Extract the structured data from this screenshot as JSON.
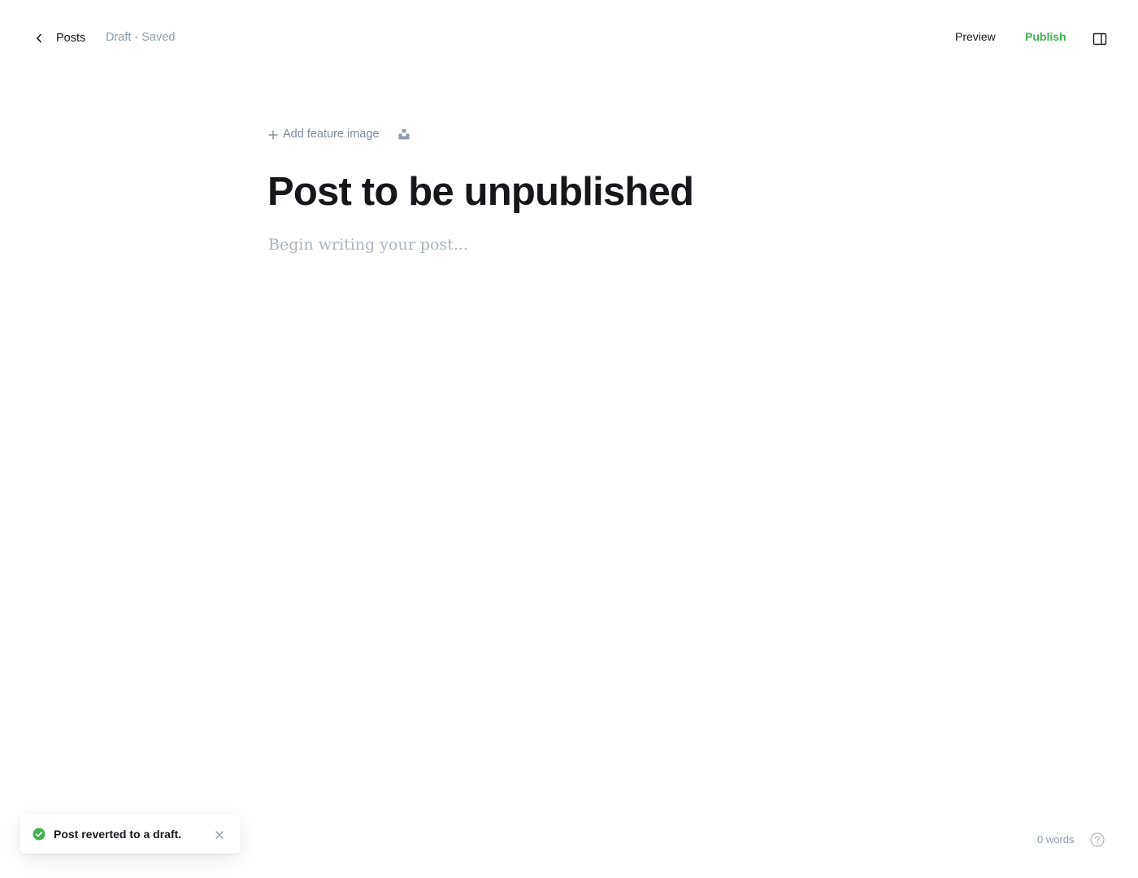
{
  "header": {
    "back_label": "Posts",
    "status": "Draft - Saved",
    "preview_label": "Preview",
    "publish_label": "Publish",
    "icons": {
      "back": "chevron-left-icon",
      "sidebar": "sidebar-toggle-icon"
    }
  },
  "editor": {
    "add_feature_image_label": "Add feature image",
    "title": "Post to be unpublished",
    "body_placeholder": "Begin writing your post...",
    "icons": {
      "add": "plus-icon",
      "unsplash": "unsplash-icon"
    }
  },
  "toast": {
    "message": "Post reverted to a draft.",
    "icons": {
      "status": "check-circle-icon",
      "close": "close-icon"
    }
  },
  "footer": {
    "word_count": "0 words",
    "icons": {
      "help": "help-circle-icon"
    }
  },
  "colors": {
    "accent_green": "#3db24b",
    "text": "#15171a",
    "muted": "#8e9cac",
    "placeholder": "#abb4be"
  }
}
